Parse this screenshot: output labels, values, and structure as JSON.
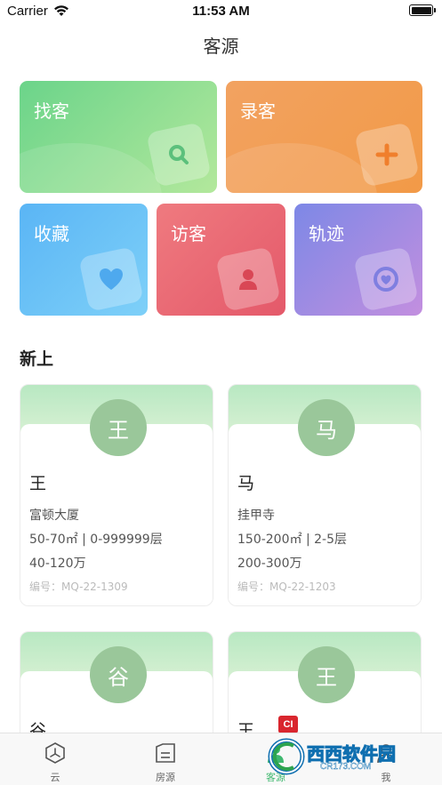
{
  "status_bar": {
    "carrier": "Carrier",
    "time": "11:53 AM"
  },
  "nav": {
    "title": "客源"
  },
  "tiles": [
    {
      "label": "找客",
      "icon": "search-icon"
    },
    {
      "label": "录客",
      "icon": "plus-icon"
    },
    {
      "label": "收藏",
      "icon": "heart-icon"
    },
    {
      "label": "访客",
      "icon": "person-icon"
    },
    {
      "label": "轨迹",
      "icon": "track-icon"
    }
  ],
  "section": {
    "title": "新上"
  },
  "cards": [
    {
      "avatar": "王",
      "name": "王",
      "building": "富顿大厦",
      "area_floor": "50-70㎡ | 0-999999层",
      "price": "40-120万",
      "code": "编号：MQ-22-1309"
    },
    {
      "avatar": "马",
      "name": "马",
      "building": "挂甲寺",
      "area_floor": "150-200㎡ | 2-5层",
      "price": "200-300万",
      "code": "编号：MQ-22-1203"
    },
    {
      "avatar": "谷",
      "name": "谷"
    },
    {
      "avatar": "王",
      "name": "王",
      "tag": "CI"
    }
  ],
  "tabbar": [
    {
      "label": "云",
      "icon": "cloud-hex-icon",
      "active": false
    },
    {
      "label": "房源",
      "icon": "house-doc-icon",
      "active": false
    },
    {
      "label": "客源",
      "icon": "customer-icon",
      "active": true
    },
    {
      "label": "我",
      "icon": "me-icon",
      "active": false
    }
  ],
  "watermark": {
    "text": "西西软件园",
    "sub": "CR173.COM"
  },
  "colors": {
    "accent": "#3fb86f",
    "avatar": "#9ac79a"
  }
}
